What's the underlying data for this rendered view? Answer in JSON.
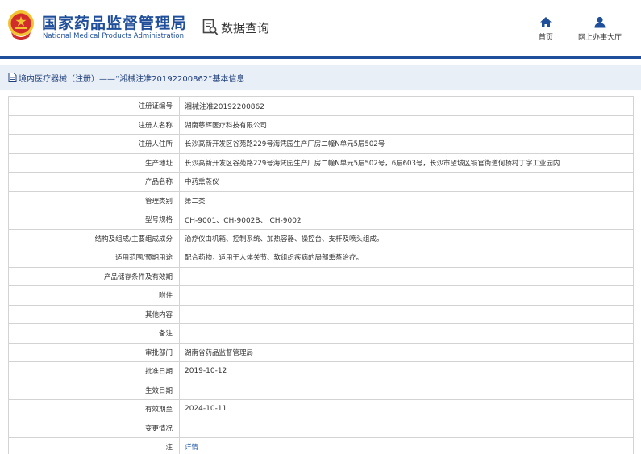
{
  "header": {
    "brand_cn": "国家药品监督管理局",
    "brand_en": "National Medical Products Administration",
    "data_search": "数据查询",
    "nav": {
      "home": "首页",
      "online_hall": "网上办事大厅"
    }
  },
  "colors": {
    "brand": "#1f4e9a",
    "crumb_bg": "#e8eff7",
    "link": "#2b5ea8",
    "logo_red": "#d22b2b",
    "logo_gold": "#f2c230"
  },
  "breadcrumb": "境内医疗器械（注册）——“湘械注准20192200862”基本信息",
  "rows": [
    {
      "label": "注册证编号",
      "value": "湘械注准20192200862"
    },
    {
      "label": "注册人名称",
      "value": "湖南慈辉医疗科技有限公司"
    },
    {
      "label": "注册人住所",
      "value": "长沙高新开发区谷苑路229号海凭园生产厂房二幢N单元5层502号"
    },
    {
      "label": "生产地址",
      "value": "长沙高新开发区谷苑路229号海凭园生产厂房二幢N单元5层502号，6层603号，长沙市望城区铜官街道何桥村丁字工业园内"
    },
    {
      "label": "产品名称",
      "value": "中药熏蒸仪"
    },
    {
      "label": "管理类别",
      "value": "第二类"
    },
    {
      "label": "型号规格",
      "value": "CH-9001、CH-9002B、 CH-9002"
    },
    {
      "label": "结构及组成/主要组成成分",
      "value": "治疗仪由机箱、控制系统、加热容器、操控台、支杆及喷头组成。"
    },
    {
      "label": "适用范围/预期用途",
      "value": "配合药物，适用于人体关节、软组织疾病的局部熏蒸治疗。"
    },
    {
      "label": "产品储存条件及有效期",
      "value": ""
    },
    {
      "label": "附件",
      "value": ""
    },
    {
      "label": "其他内容",
      "value": ""
    },
    {
      "label": "备注",
      "value": ""
    },
    {
      "label": "审批部门",
      "value": "湖南省药品监督管理局"
    },
    {
      "label": "批准日期",
      "value": "2019-10-12"
    },
    {
      "label": "生效日期",
      "value": ""
    },
    {
      "label": "有效期至",
      "value": "2024-10-11"
    },
    {
      "label": "变更情况",
      "value": ""
    },
    {
      "label": "注",
      "value": "详情"
    }
  ]
}
